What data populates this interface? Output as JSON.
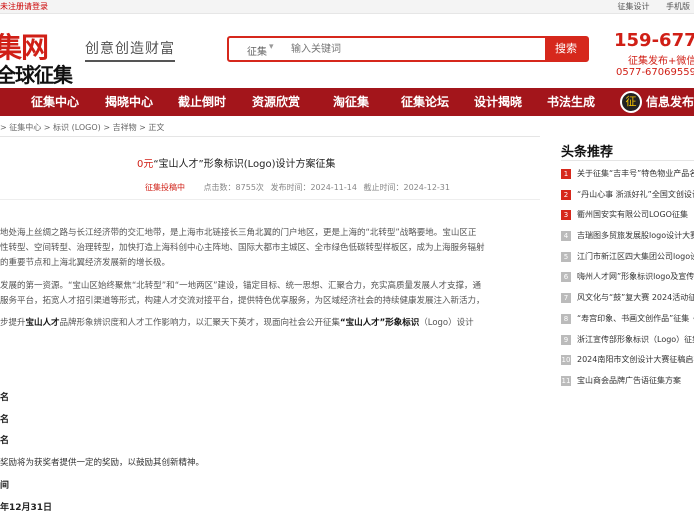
{
  "topbar": {
    "login": "未注册请登录",
    "links": [
      "征集设计",
      "手机版"
    ]
  },
  "header": {
    "logo_top": "集网",
    "logo_bottom": "全球征集",
    "slogan": "创意创造财富",
    "search_category": "征集",
    "search_placeholder": "输入关键词",
    "search_button": "搜索",
    "hotline": "159-677-",
    "hotline_sub": "征集发布+微信",
    "hotline_tel": "0577-67069559"
  },
  "nav": {
    "items": [
      "征集中心",
      "揭晓中心",
      "截止倒时",
      "资源欣赏",
      "淘征集",
      "征集论坛",
      "设计揭晓",
      "书法生成"
    ],
    "badge": "征",
    "info": "信息发布"
  },
  "breadcrumb": "> 征集中心 > 标识 (LOGO) > 吉祥物 > 正文",
  "article": {
    "tag": "0元",
    "title": "“宝山人才”形象标识(Logo)设计方案征集",
    "status": "征集投稿中",
    "views": "点击数：8755次",
    "published": "发布时间：2024-11-14",
    "deadline": "截止时间：2024-12-31",
    "paragraphs": [
      [
        "地处海上丝绸之路与长江经济带的交汇地带，是上海市北链接长三角北翼的门户地区，更是上海的“北转型”战略要地。宝山区正"
      ],
      [
        "性转型、空间转型、治理转型，加快打造上海科创中心主阵地、国际大都市主城区、全市绿色低碳转型样板区，成为上海服务辐射"
      ],
      [
        "的重要节点和上海北翼经济发展新的增长极。"
      ],
      [
        "发展的第一资源。“宝山区始终聚焦“北转型”和“一地两区”建设，锚定目标、统一思想、汇聚合力，充实高质量发展人才支撑，通"
      ],
      [
        "服务平台，拓宽人才招引渠道等形式，构建人才交流对接平台，提供特色优享服务，为区域经济社会的持续健康发展注入新活力，"
      ],
      [
        "步提升",
        "宝山人才",
        "品牌形象辨识度和人才工作影响力，以汇聚天下英才，现面向社会公开征集",
        "“宝山人才”形象标识",
        "（Logo）设计"
      ]
    ],
    "award_labels": [
      "名",
      "名",
      "名"
    ],
    "award_note": "奖励将为获奖者提供一定的奖励，以鼓励其创新精神。",
    "time_label": "间",
    "deadline_label": "年12月31日"
  },
  "sidebar": {
    "title": "头条推荐",
    "items": [
      {
        "num": "1",
        "text": "关于征集“吉丰号”特色物业产品名"
      },
      {
        "num": "2",
        "text": "“丹山心事 浙派好礼”全国文创设计"
      },
      {
        "num": "3",
        "text": "衢州国安实有限公司LOGO征集"
      },
      {
        "num": "4",
        "text": "吉瑞图多贸旅发展股logo设计大赛"
      },
      {
        "num": "5",
        "text": "江门市新江区四大集团公司logo设计"
      },
      {
        "num": "6",
        "text": "嗨州人才网”形象标识logo及宣传语"
      },
      {
        "num": "7",
        "text": "风文化与“鼓”复大赛 2024活动征集"
      },
      {
        "num": "8",
        "text": "“寿宫印象、书画文创作品”征集《翰"
      },
      {
        "num": "9",
        "text": "浙江宣传部形象标识（Logo）征集"
      },
      {
        "num": "10",
        "text": "2024南阳市文创设计大赛征稿启事"
      },
      {
        "num": "11",
        "text": "宝山商会品牌广告语征集方案"
      }
    ]
  }
}
